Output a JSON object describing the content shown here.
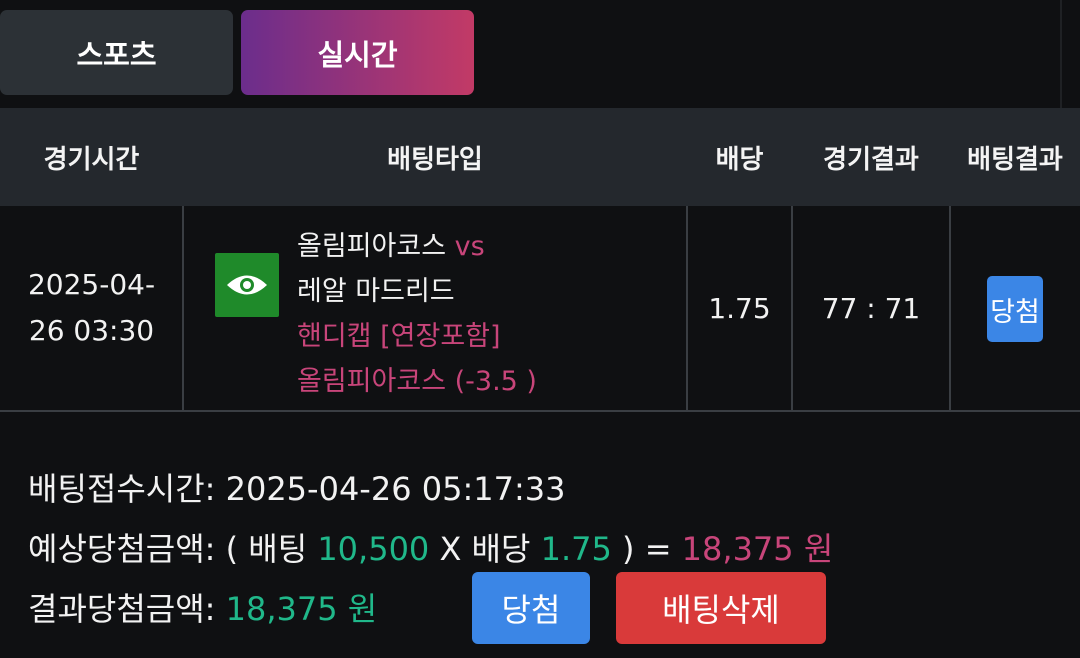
{
  "tabs": [
    {
      "label": "스포츠"
    },
    {
      "label": "실시간"
    }
  ],
  "table": {
    "headers": [
      "경기시간",
      "배팅타입",
      "배당",
      "경기결과",
      "배팅결과"
    ],
    "row": {
      "time_line1": "2025-04-",
      "time_line2": "26 03:30",
      "icon": "eye-icon",
      "home_team": "올림피아코스",
      "vs": "vs",
      "away_team": "레알 마드리드",
      "market": "핸디캡 [연장포함]",
      "pick": "올림피아코스 (-3.5 )",
      "odds": "1.75",
      "score": "77 : 71",
      "result": "당첨"
    }
  },
  "summary": {
    "accepted_label": "배팅접수시간:",
    "accepted_time": "2025-04-26 05:17:33",
    "expected_label": "예상당첨금액:",
    "open_paren": "(",
    "bet_word": "배팅",
    "bet_amount": "10,500",
    "x": "X",
    "odds_word": "배당",
    "odds_value": "1.75",
    "close_paren": ")",
    "equals": "=",
    "expected_amount": "18,375 원",
    "result_label": "결과당첨금액:",
    "result_amount": "18,375 원"
  },
  "buttons": {
    "win": "당첨",
    "delete": "배팅삭제"
  },
  "colors": {
    "accent_pink": "#c8457a",
    "accent_green": "#20b88a",
    "win_blue": "#3b86e6",
    "delete_red": "#d93a3a"
  }
}
